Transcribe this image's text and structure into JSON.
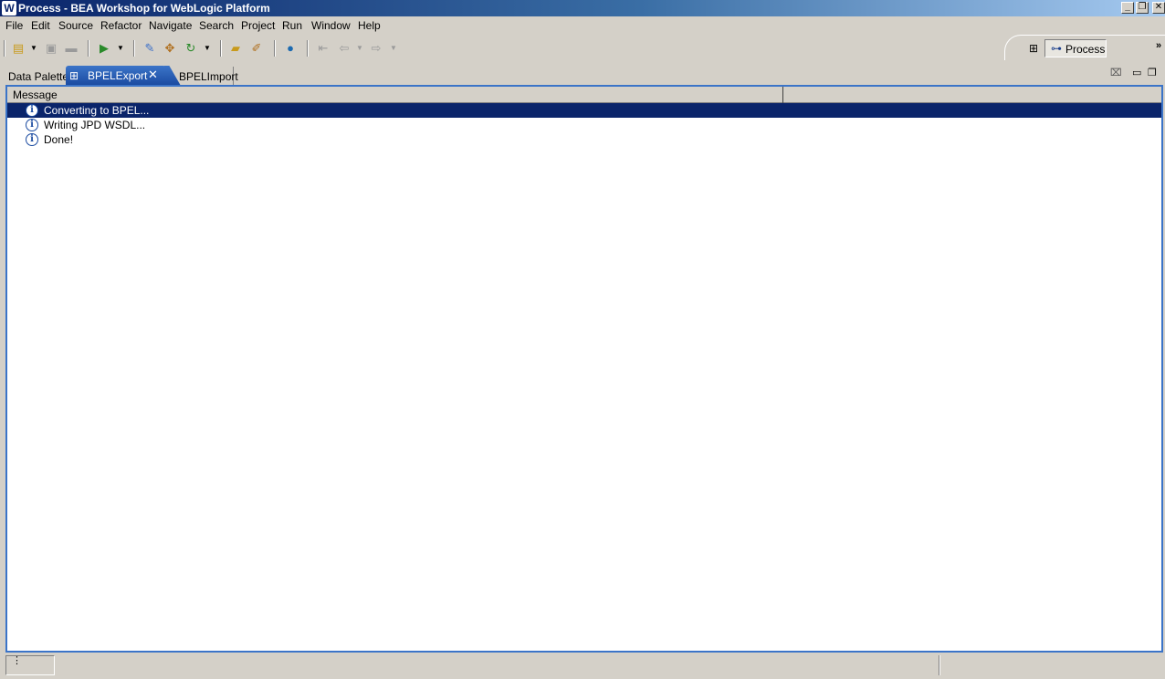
{
  "window": {
    "title": "Process - BEA Workshop for WebLogic Platform",
    "app_icon": "W"
  },
  "menu": [
    "File",
    "Edit",
    "Source",
    "Refactor",
    "Navigate",
    "Search",
    "Project",
    "Run",
    "Window",
    "Help"
  ],
  "toolbar": {
    "icons": [
      "new-icon",
      "save-icon",
      "print-icon",
      "run-icon",
      "open-type-icon",
      "build-icon",
      "refresh-icon",
      "open-folder-icon",
      "wrench-icon",
      "globe-icon",
      "back-icon",
      "forward-icon"
    ]
  },
  "perspective": {
    "active": "Process"
  },
  "tabs": {
    "data_palette": "Data Palette",
    "bpel_export": "BPELExport",
    "bpel_import": "BPELImport"
  },
  "table": {
    "columns": [
      "Message",
      ""
    ],
    "rows": [
      {
        "message": "Converting to BPEL...",
        "selected": true,
        "icon": "info-icon"
      },
      {
        "message": "Writing JPD WSDL...",
        "selected": false,
        "icon": "info-icon"
      },
      {
        "message": "Done!",
        "selected": false,
        "icon": "info-icon"
      }
    ]
  },
  "colors": {
    "titlebar_start": "#0a246a",
    "active_tab": "#3b74c8",
    "selection": "#0a246a"
  }
}
